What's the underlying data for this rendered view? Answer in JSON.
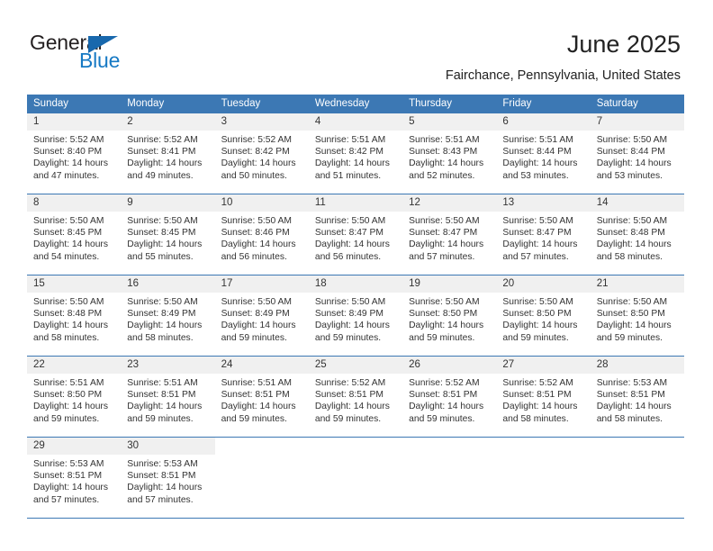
{
  "brand": {
    "name_part1": "General",
    "name_part2": "Blue",
    "accent_color": "#1679c4",
    "triangle_color": "#1868ad"
  },
  "header": {
    "title": "June 2025",
    "location": "Fairchance, Pennsylvania, United States",
    "header_bg_color": "#3c78b4",
    "daynum_bg_color": "#f0f0f0"
  },
  "weekdays": [
    "Sunday",
    "Monday",
    "Tuesday",
    "Wednesday",
    "Thursday",
    "Friday",
    "Saturday"
  ],
  "weeks": [
    [
      {
        "day": "1",
        "sunrise": "Sunrise: 5:52 AM",
        "sunset": "Sunset: 8:40 PM",
        "daylight": "Daylight: 14 hours and 47 minutes."
      },
      {
        "day": "2",
        "sunrise": "Sunrise: 5:52 AM",
        "sunset": "Sunset: 8:41 PM",
        "daylight": "Daylight: 14 hours and 49 minutes."
      },
      {
        "day": "3",
        "sunrise": "Sunrise: 5:52 AM",
        "sunset": "Sunset: 8:42 PM",
        "daylight": "Daylight: 14 hours and 50 minutes."
      },
      {
        "day": "4",
        "sunrise": "Sunrise: 5:51 AM",
        "sunset": "Sunset: 8:42 PM",
        "daylight": "Daylight: 14 hours and 51 minutes."
      },
      {
        "day": "5",
        "sunrise": "Sunrise: 5:51 AM",
        "sunset": "Sunset: 8:43 PM",
        "daylight": "Daylight: 14 hours and 52 minutes."
      },
      {
        "day": "6",
        "sunrise": "Sunrise: 5:51 AM",
        "sunset": "Sunset: 8:44 PM",
        "daylight": "Daylight: 14 hours and 53 minutes."
      },
      {
        "day": "7",
        "sunrise": "Sunrise: 5:50 AM",
        "sunset": "Sunset: 8:44 PM",
        "daylight": "Daylight: 14 hours and 53 minutes."
      }
    ],
    [
      {
        "day": "8",
        "sunrise": "Sunrise: 5:50 AM",
        "sunset": "Sunset: 8:45 PM",
        "daylight": "Daylight: 14 hours and 54 minutes."
      },
      {
        "day": "9",
        "sunrise": "Sunrise: 5:50 AM",
        "sunset": "Sunset: 8:45 PM",
        "daylight": "Daylight: 14 hours and 55 minutes."
      },
      {
        "day": "10",
        "sunrise": "Sunrise: 5:50 AM",
        "sunset": "Sunset: 8:46 PM",
        "daylight": "Daylight: 14 hours and 56 minutes."
      },
      {
        "day": "11",
        "sunrise": "Sunrise: 5:50 AM",
        "sunset": "Sunset: 8:47 PM",
        "daylight": "Daylight: 14 hours and 56 minutes."
      },
      {
        "day": "12",
        "sunrise": "Sunrise: 5:50 AM",
        "sunset": "Sunset: 8:47 PM",
        "daylight": "Daylight: 14 hours and 57 minutes."
      },
      {
        "day": "13",
        "sunrise": "Sunrise: 5:50 AM",
        "sunset": "Sunset: 8:47 PM",
        "daylight": "Daylight: 14 hours and 57 minutes."
      },
      {
        "day": "14",
        "sunrise": "Sunrise: 5:50 AM",
        "sunset": "Sunset: 8:48 PM",
        "daylight": "Daylight: 14 hours and 58 minutes."
      }
    ],
    [
      {
        "day": "15",
        "sunrise": "Sunrise: 5:50 AM",
        "sunset": "Sunset: 8:48 PM",
        "daylight": "Daylight: 14 hours and 58 minutes."
      },
      {
        "day": "16",
        "sunrise": "Sunrise: 5:50 AM",
        "sunset": "Sunset: 8:49 PM",
        "daylight": "Daylight: 14 hours and 58 minutes."
      },
      {
        "day": "17",
        "sunrise": "Sunrise: 5:50 AM",
        "sunset": "Sunset: 8:49 PM",
        "daylight": "Daylight: 14 hours and 59 minutes."
      },
      {
        "day": "18",
        "sunrise": "Sunrise: 5:50 AM",
        "sunset": "Sunset: 8:49 PM",
        "daylight": "Daylight: 14 hours and 59 minutes."
      },
      {
        "day": "19",
        "sunrise": "Sunrise: 5:50 AM",
        "sunset": "Sunset: 8:50 PM",
        "daylight": "Daylight: 14 hours and 59 minutes."
      },
      {
        "day": "20",
        "sunrise": "Sunrise: 5:50 AM",
        "sunset": "Sunset: 8:50 PM",
        "daylight": "Daylight: 14 hours and 59 minutes."
      },
      {
        "day": "21",
        "sunrise": "Sunrise: 5:50 AM",
        "sunset": "Sunset: 8:50 PM",
        "daylight": "Daylight: 14 hours and 59 minutes."
      }
    ],
    [
      {
        "day": "22",
        "sunrise": "Sunrise: 5:51 AM",
        "sunset": "Sunset: 8:50 PM",
        "daylight": "Daylight: 14 hours and 59 minutes."
      },
      {
        "day": "23",
        "sunrise": "Sunrise: 5:51 AM",
        "sunset": "Sunset: 8:51 PM",
        "daylight": "Daylight: 14 hours and 59 minutes."
      },
      {
        "day": "24",
        "sunrise": "Sunrise: 5:51 AM",
        "sunset": "Sunset: 8:51 PM",
        "daylight": "Daylight: 14 hours and 59 minutes."
      },
      {
        "day": "25",
        "sunrise": "Sunrise: 5:52 AM",
        "sunset": "Sunset: 8:51 PM",
        "daylight": "Daylight: 14 hours and 59 minutes."
      },
      {
        "day": "26",
        "sunrise": "Sunrise: 5:52 AM",
        "sunset": "Sunset: 8:51 PM",
        "daylight": "Daylight: 14 hours and 59 minutes."
      },
      {
        "day": "27",
        "sunrise": "Sunrise: 5:52 AM",
        "sunset": "Sunset: 8:51 PM",
        "daylight": "Daylight: 14 hours and 58 minutes."
      },
      {
        "day": "28",
        "sunrise": "Sunrise: 5:53 AM",
        "sunset": "Sunset: 8:51 PM",
        "daylight": "Daylight: 14 hours and 58 minutes."
      }
    ],
    [
      {
        "day": "29",
        "sunrise": "Sunrise: 5:53 AM",
        "sunset": "Sunset: 8:51 PM",
        "daylight": "Daylight: 14 hours and 57 minutes."
      },
      {
        "day": "30",
        "sunrise": "Sunrise: 5:53 AM",
        "sunset": "Sunset: 8:51 PM",
        "daylight": "Daylight: 14 hours and 57 minutes."
      },
      {
        "day": "",
        "sunrise": "",
        "sunset": "",
        "daylight": ""
      },
      {
        "day": "",
        "sunrise": "",
        "sunset": "",
        "daylight": ""
      },
      {
        "day": "",
        "sunrise": "",
        "sunset": "",
        "daylight": ""
      },
      {
        "day": "",
        "sunrise": "",
        "sunset": "",
        "daylight": ""
      },
      {
        "day": "",
        "sunrise": "",
        "sunset": "",
        "daylight": ""
      }
    ]
  ]
}
